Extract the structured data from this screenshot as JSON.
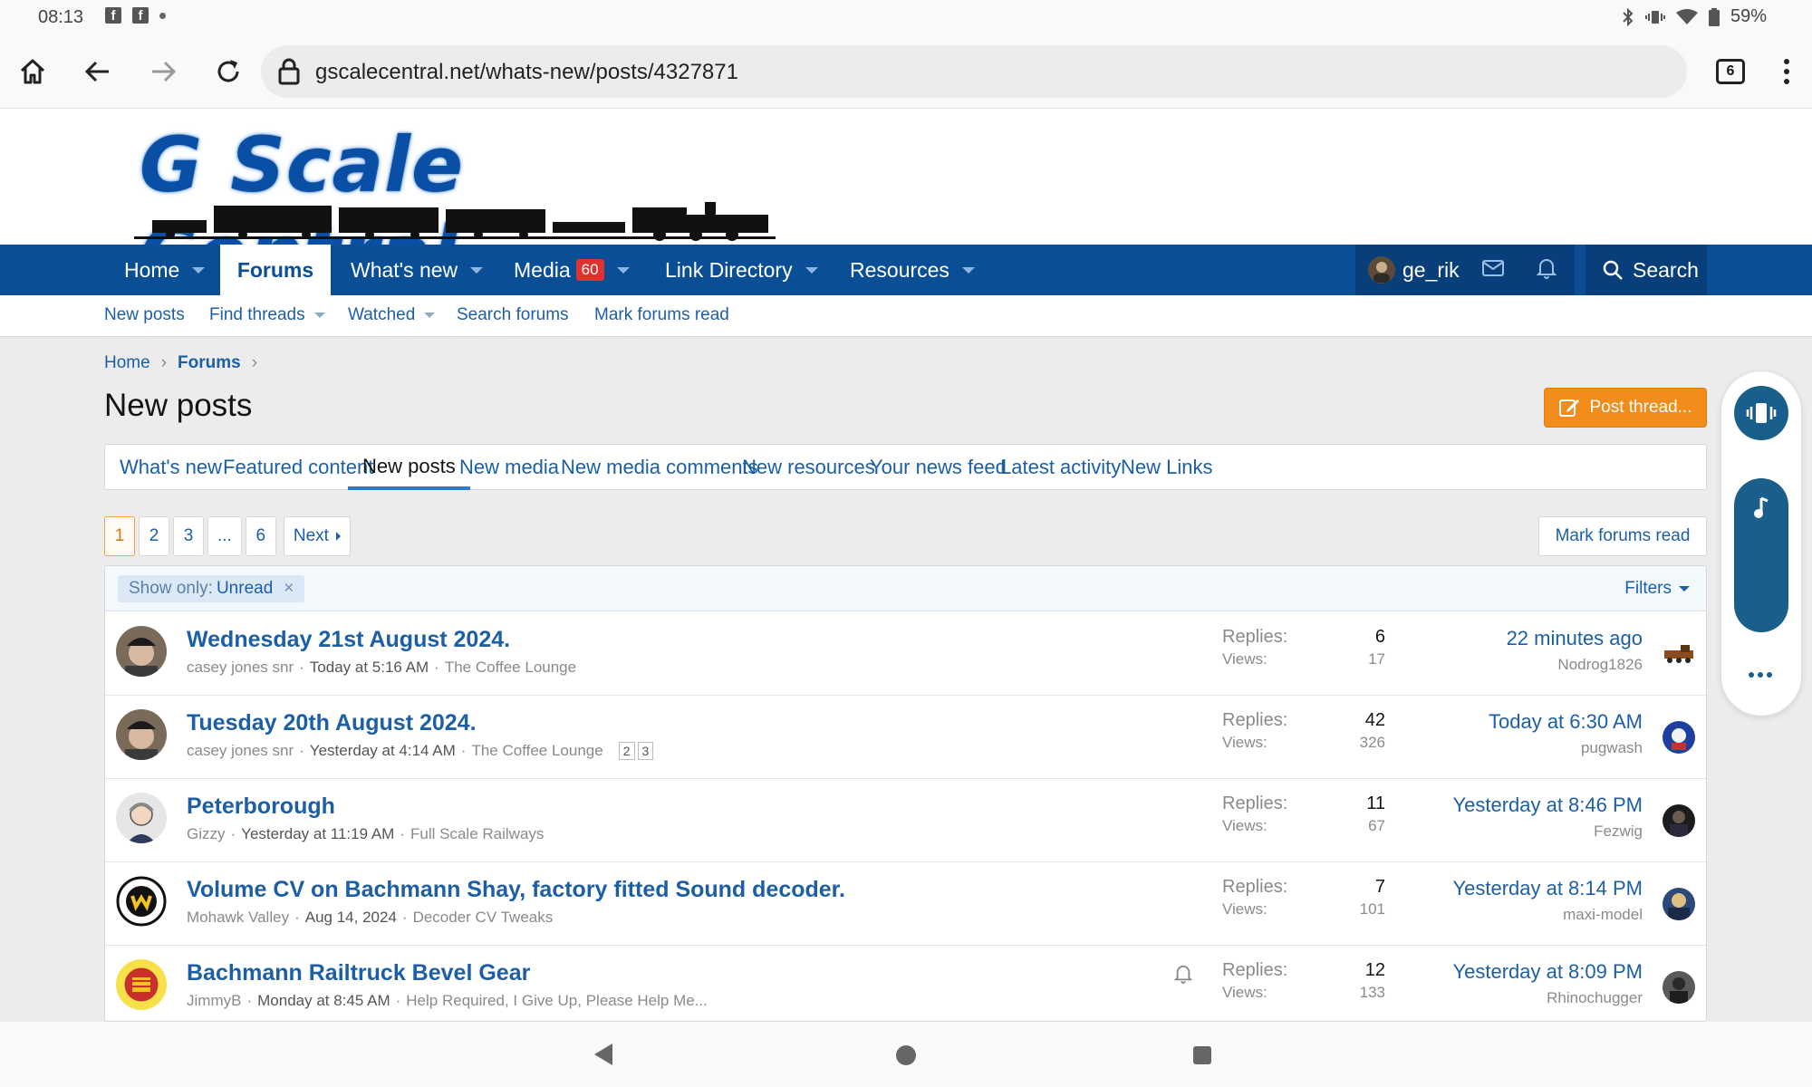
{
  "status_bar": {
    "time": "08:13",
    "battery": "59%"
  },
  "browser": {
    "url": "gscalecentral.net/whats-new/posts/4327871",
    "tab_count": "6"
  },
  "site": {
    "logo_text": "G Scale Central"
  },
  "main_nav": {
    "home": "Home",
    "forums": "Forums",
    "whats_new": "What's new",
    "media": "Media",
    "media_badge": "60",
    "link_directory": "Link Directory",
    "resources": "Resources",
    "username": "ge_rik",
    "search": "Search"
  },
  "sub_nav": {
    "new_posts": "New posts",
    "find_threads": "Find threads",
    "watched": "Watched",
    "search_forums": "Search forums",
    "mark_forums_read": "Mark forums read"
  },
  "breadcrumb": {
    "home": "Home",
    "forums": "Forums"
  },
  "page": {
    "title": "New posts",
    "post_thread": "Post thread..."
  },
  "tabs": [
    "What's new",
    "Featured content",
    "New posts",
    "New media",
    "New media comments",
    "New resources",
    "Your news feed",
    "Latest activity",
    "New Links"
  ],
  "pager": {
    "pages": [
      "1",
      "2",
      "3",
      "...",
      "6"
    ],
    "next": "Next",
    "mark_read": "Mark forums read"
  },
  "filter": {
    "label": "Show only:",
    "value": "Unread",
    "filters": "Filters"
  },
  "threads": [
    {
      "title": "Wednesday 21st August 2024.",
      "author": "casey jones snr",
      "date": "Today at 5:16 AM",
      "forum": "The Coffee Lounge",
      "pages": [],
      "replies_label": "Replies:",
      "replies": "6",
      "views_label": "Views:",
      "views": "17",
      "last_time": "22 minutes ago",
      "last_user": "Nodrog1826"
    },
    {
      "title": "Tuesday 20th August 2024.",
      "author": "casey jones snr",
      "date": "Yesterday at 4:14 AM",
      "forum": "The Coffee Lounge",
      "pages": [
        "2",
        "3"
      ],
      "replies_label": "Replies:",
      "replies": "42",
      "views_label": "Views:",
      "views": "326",
      "last_time": "Today at 6:30 AM",
      "last_user": "pugwash"
    },
    {
      "title": "Peterborough",
      "author": "Gizzy",
      "date": "Yesterday at 11:19 AM",
      "forum": "Full Scale Railways",
      "pages": [],
      "replies_label": "Replies:",
      "replies": "11",
      "views_label": "Views:",
      "views": "67",
      "last_time": "Yesterday at 8:46 PM",
      "last_user": "Fezwig"
    },
    {
      "title": "Volume CV on Bachmann Shay, factory fitted Sound decoder.",
      "author": "Mohawk Valley",
      "date": "Aug 14, 2024",
      "forum": "Decoder CV Tweaks",
      "pages": [],
      "replies_label": "Replies:",
      "replies": "7",
      "views_label": "Views:",
      "views": "101",
      "last_time": "Yesterday at 8:14 PM",
      "last_user": "maxi-model"
    },
    {
      "title": "Bachmann Railtruck Bevel Gear",
      "author": "JimmyB",
      "date": "Monday at 8:45 AM",
      "forum": "Help Required, I Give Up, Please Help Me...",
      "pages": [],
      "replies_label": "Replies:",
      "replies": "12",
      "views_label": "Views:",
      "views": "133",
      "last_time": "Yesterday at 8:09 PM",
      "last_user": "Rhinochugger"
    }
  ]
}
